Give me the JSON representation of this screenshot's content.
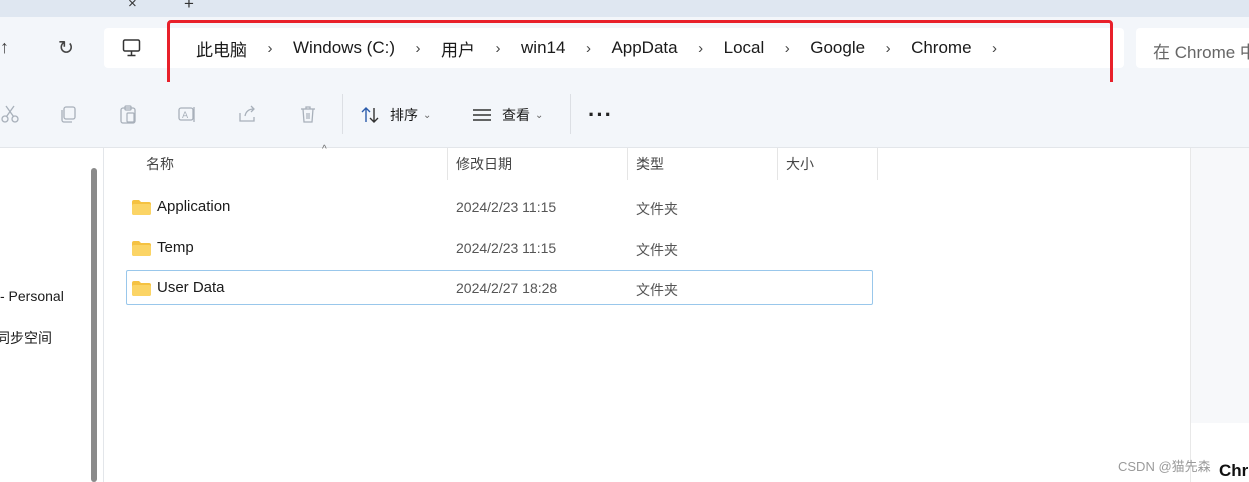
{
  "tabstrip": {
    "close_glyph": "×",
    "add_glyph": "+"
  },
  "nav": {
    "up_glyph": "↑",
    "refresh_glyph": "↻"
  },
  "address": {
    "location_icon": "computer-icon",
    "separator": "›",
    "crumbs": [
      "此电脑",
      "Windows (C:)",
      "用户",
      "win14",
      "AppData",
      "Local",
      "Google",
      "Chrome"
    ]
  },
  "search": {
    "placeholder": "在 Chrome 中"
  },
  "highlight_color": "#e8202a",
  "toolbar": {
    "icons": [
      "cut-icon",
      "copy-icon",
      "paste-icon",
      "rename-icon",
      "share-icon",
      "delete-icon"
    ],
    "sort_label": "排序",
    "view_label": "查看",
    "more_label": "···",
    "chevron": "⌄"
  },
  "navpane": {
    "items": [
      "- Personal",
      "同步空间"
    ]
  },
  "columns": {
    "name": "名称",
    "modified": "修改日期",
    "type": "类型",
    "size": "大小",
    "sort_caret": "^"
  },
  "files": [
    {
      "name": "Application",
      "modified": "2024/2/23 11:15",
      "type": "文件夹",
      "selected": false
    },
    {
      "name": "Temp",
      "modified": "2024/2/23 11:15",
      "type": "文件夹",
      "selected": false
    },
    {
      "name": "User Data",
      "modified": "2024/2/27 18:28",
      "type": "文件夹",
      "selected": true
    }
  ],
  "overlay": {
    "partial_text": "Chr",
    "watermark": "CSDN @猫先森"
  },
  "colors": {
    "folder": "#f5c242",
    "selection_border": "#99c7eb",
    "chrome_bg": "#f3f6fa"
  }
}
